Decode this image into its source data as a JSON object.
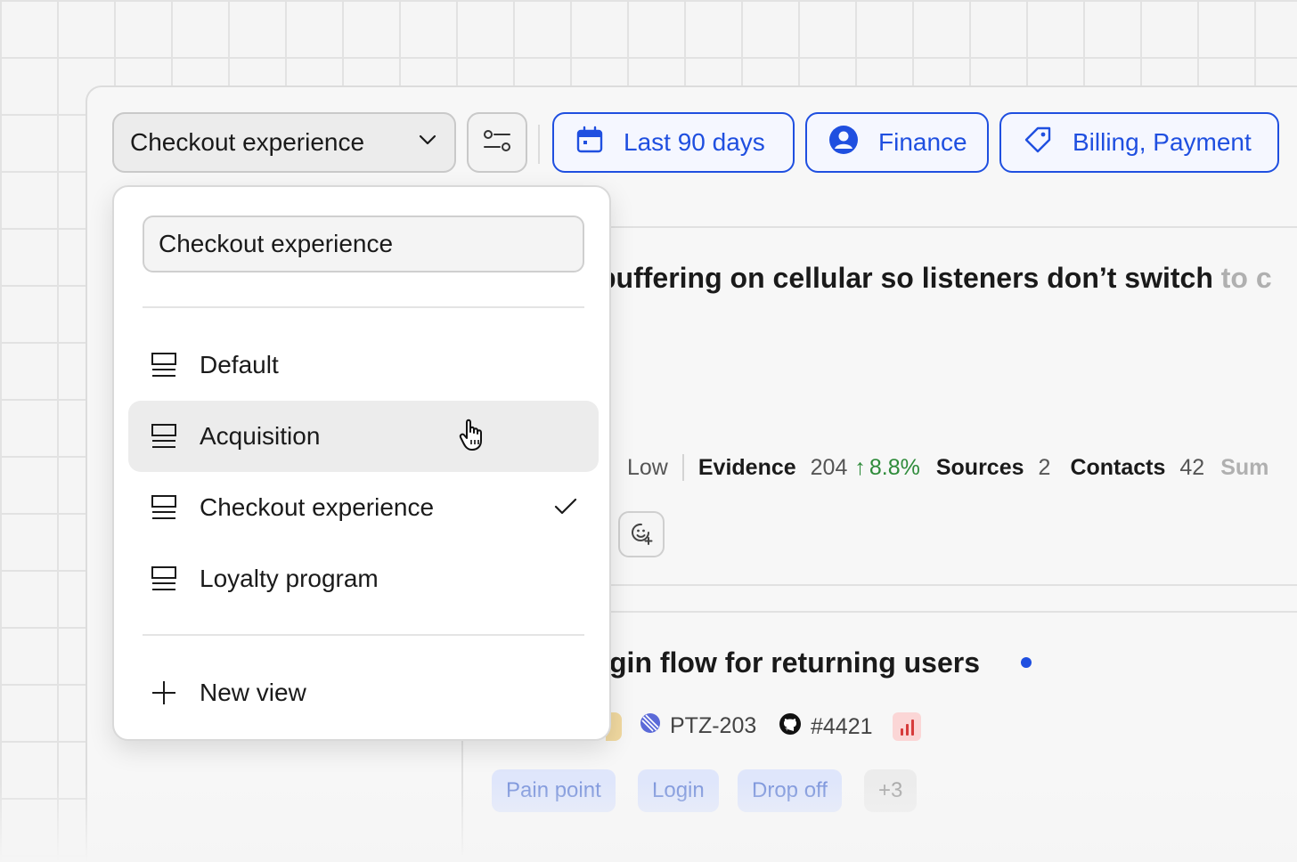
{
  "toolbar": {
    "view_select_label": "Checkout experience",
    "date_filter": "Last 90 days",
    "team_filter": "Finance",
    "tags_filter": "Billing, Payment"
  },
  "rows": [
    {
      "title_visible": "buffering on cellular so listeners don’t switch",
      "title_faded": "to c",
      "meta": {
        "priority": "Low",
        "evidence_label": "Evidence",
        "evidence_value": "204",
        "evidence_change": "8.8%",
        "sources_label": "Sources",
        "sources_value": "2",
        "contacts_label": "Contacts",
        "contacts_value": "42",
        "trailing": "Sum"
      }
    },
    {
      "title_visible": "gin flow for returning users",
      "ref_linear": "PTZ-203",
      "ref_github": "#4421",
      "tags": [
        "Pain point",
        "Login",
        "Drop off"
      ],
      "more_tags": "+3"
    }
  ],
  "menu": {
    "search_value": "Checkout experience",
    "items": [
      {
        "label": "Default"
      },
      {
        "label": "Acquisition"
      },
      {
        "label": "Checkout experience"
      },
      {
        "label": "Loyalty program"
      }
    ],
    "new_view_label": "New view"
  },
  "colors": {
    "accent": "#1f4fe0",
    "positive": "#2e8b3a",
    "hover_bg": "#ececec"
  }
}
